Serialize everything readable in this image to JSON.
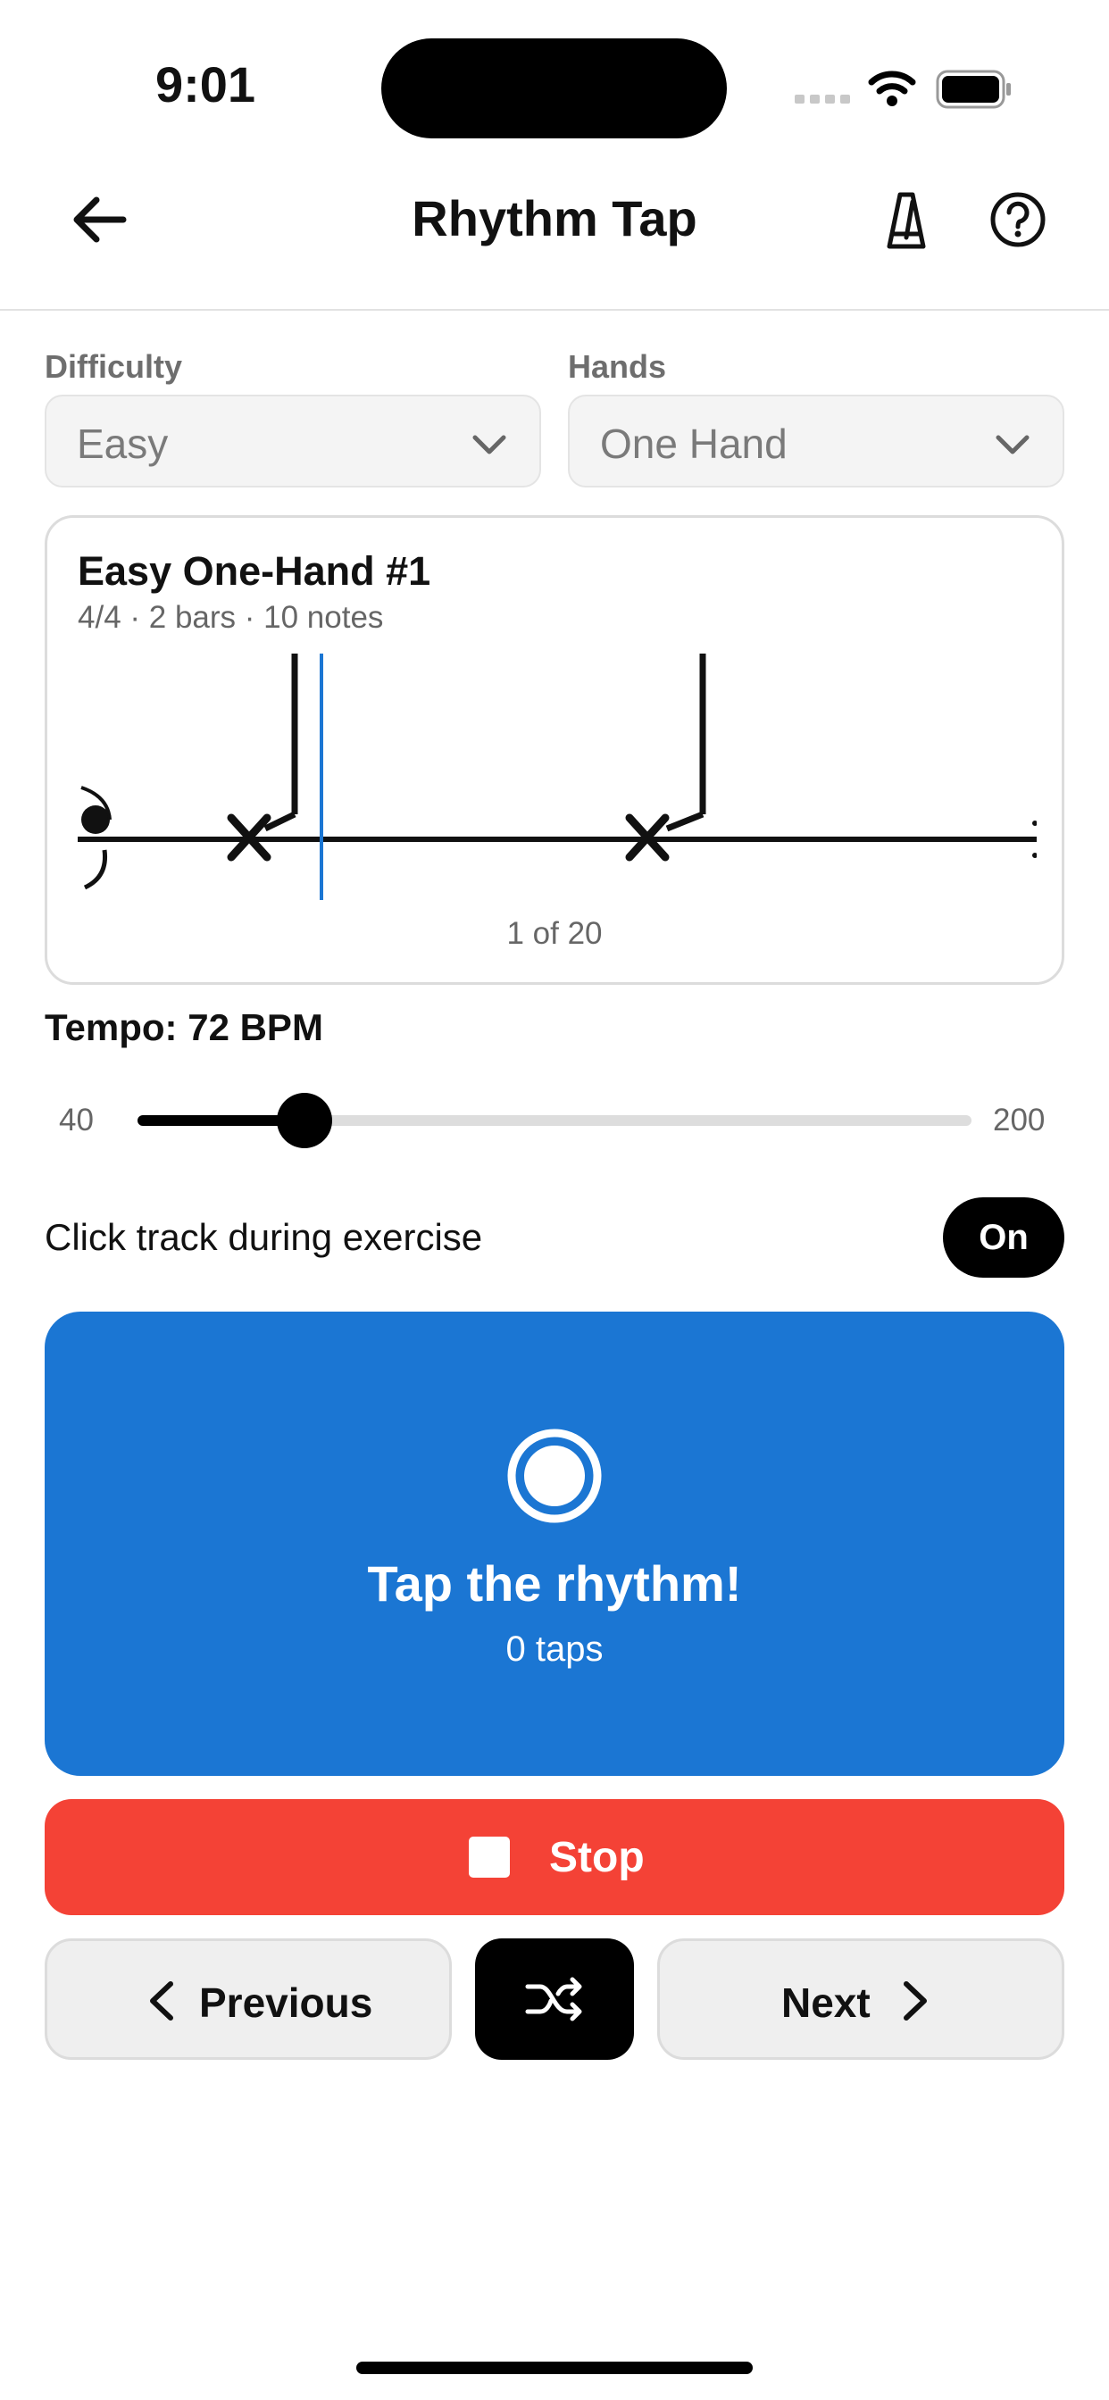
{
  "status_bar": {
    "time": "9:01"
  },
  "header": {
    "title": "Rhythm Tap",
    "icons": [
      "back-arrow-icon",
      "metronome-icon",
      "help-circle-icon"
    ]
  },
  "filters": {
    "difficulty": {
      "label": "Difficulty",
      "value": "Easy"
    },
    "hands": {
      "label": "Hands",
      "value": "One Hand"
    }
  },
  "exercise": {
    "title": "Easy One-Hand #1",
    "meta": "4/4 · 2 bars · 10 notes",
    "position": "1 of 20"
  },
  "tempo": {
    "label": "Tempo: 72 BPM",
    "min": "40",
    "max": "200",
    "value": 72
  },
  "click_track": {
    "label": "Click track during exercise",
    "state": "On"
  },
  "tap_area": {
    "title": "Tap the rhythm!",
    "count": "0 taps"
  },
  "controls": {
    "stop_label": "Stop",
    "previous_label": "Previous",
    "next_label": "Next"
  },
  "colors": {
    "accent_blue": "#1b76d3",
    "stop_red": "#f44236",
    "dark": "#000000"
  }
}
